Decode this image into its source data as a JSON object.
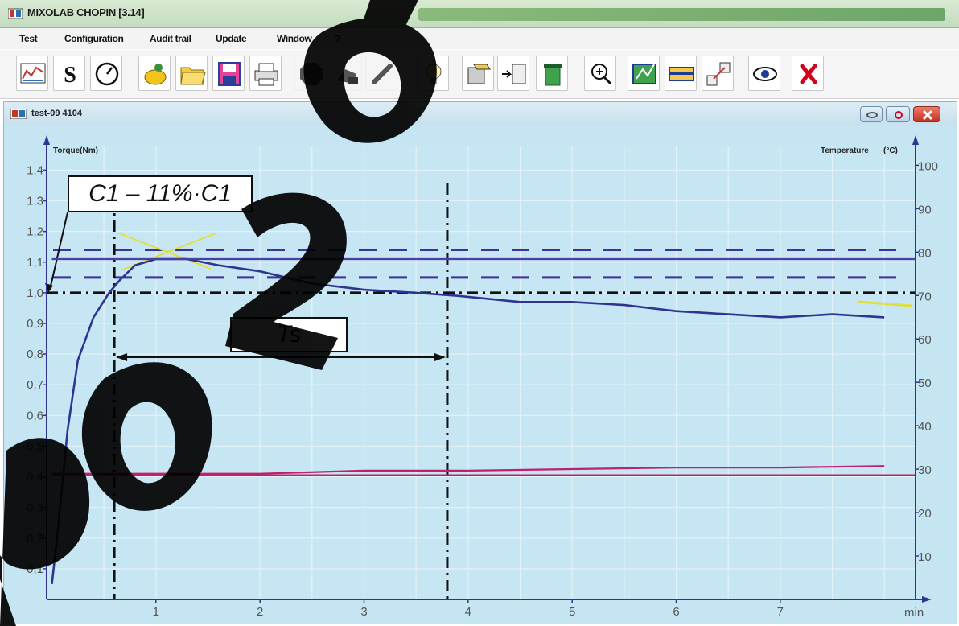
{
  "app": {
    "title": "MIXOLAB CHOPIN [3.14]"
  },
  "menu": {
    "items": [
      "Test",
      "Configuration",
      "Audit trail",
      "Update",
      "Window",
      "?"
    ]
  },
  "toolbar": {
    "icons": [
      "curve-icon",
      "s-icon",
      "dial-icon",
      "hand-icon",
      "open-folder-icon",
      "save-icon",
      "print-icon",
      "stop-icon",
      "hand-phone-icon",
      "pen-icon",
      "lightbulb-icon",
      "export-icon",
      "transfer-icon",
      "trash-icon",
      "zoom-icon",
      "chart-edit-icon",
      "card-icon",
      "flag-toggle-icon",
      "eye-icon",
      "close-red-icon"
    ]
  },
  "document": {
    "title": "test-09 4104"
  },
  "chart": {
    "y_left_label": "Torque(Nm)",
    "y_right_label": "Temperature",
    "y_right_unit": "(°C)",
    "x_unit": "min",
    "y_left_ticks": [
      "0,1",
      "0,2",
      "0,3",
      "0,4",
      "0,5",
      "0,6",
      "0,7",
      "0,8",
      "0,9",
      "1,0",
      "1,1",
      "1,2",
      "1,3",
      "1,4"
    ],
    "y_right_ticks": [
      "10",
      "20",
      "30",
      "40",
      "50",
      "60",
      "70",
      "80",
      "90",
      "100"
    ],
    "x_ticks": [
      "1",
      "2",
      "3",
      "4",
      "5",
      "6",
      "7"
    ],
    "annotation_c1": "C1 – 11%·C1",
    "annotation_ts": "Ts"
  },
  "chart_data": {
    "type": "line",
    "xlabel": "min",
    "ylabel": "Torque(Nm)",
    "y2label": "Temperature (°C)",
    "xlim": [
      -0.05,
      8.3
    ],
    "ylim": [
      0,
      1.43
    ],
    "y2lim": [
      0,
      101
    ],
    "series": [
      {
        "axis": "left",
        "color": "#2e3590",
        "x": [
          0.0,
          0.05,
          0.15,
          0.25,
          0.4,
          0.55,
          0.65,
          0.8,
          1.0,
          1.3,
          1.6,
          2.0,
          2.5,
          3.0,
          3.5,
          3.9,
          4.5,
          5.0,
          5.5,
          6.0,
          6.5,
          7.0,
          7.5,
          8.0
        ],
        "y": [
          0.05,
          0.2,
          0.55,
          0.78,
          0.92,
          1.0,
          1.04,
          1.09,
          1.11,
          1.11,
          1.09,
          1.07,
          1.03,
          1.01,
          1.0,
          0.99,
          0.97,
          0.97,
          0.96,
          0.94,
          0.93,
          0.92,
          0.93,
          0.92
        ]
      },
      {
        "axis": "left",
        "color": "#4b3fa3",
        "x": [
          0.0,
          8.3
        ],
        "y": [
          1.11,
          1.11
        ]
      },
      {
        "axis": "left",
        "color": "#c0206e",
        "x": [
          0.0,
          1.0,
          2.0,
          3.0,
          4.0,
          5.0,
          6.0,
          7.0,
          8.0
        ],
        "y": [
          0.41,
          0.41,
          0.41,
          0.42,
          0.42,
          0.425,
          0.43,
          0.43,
          0.435
        ]
      },
      {
        "axis": "left",
        "color": "#c0206e",
        "x": [
          0.0,
          8.3
        ],
        "y": [
          0.405,
          0.405
        ]
      }
    ],
    "reference_lines": {
      "upper_dashed": 1.14,
      "lower_dashed": 1.05,
      "c1_level": 1.0,
      "t_start": 0.6,
      "t_end": 3.8
    }
  }
}
